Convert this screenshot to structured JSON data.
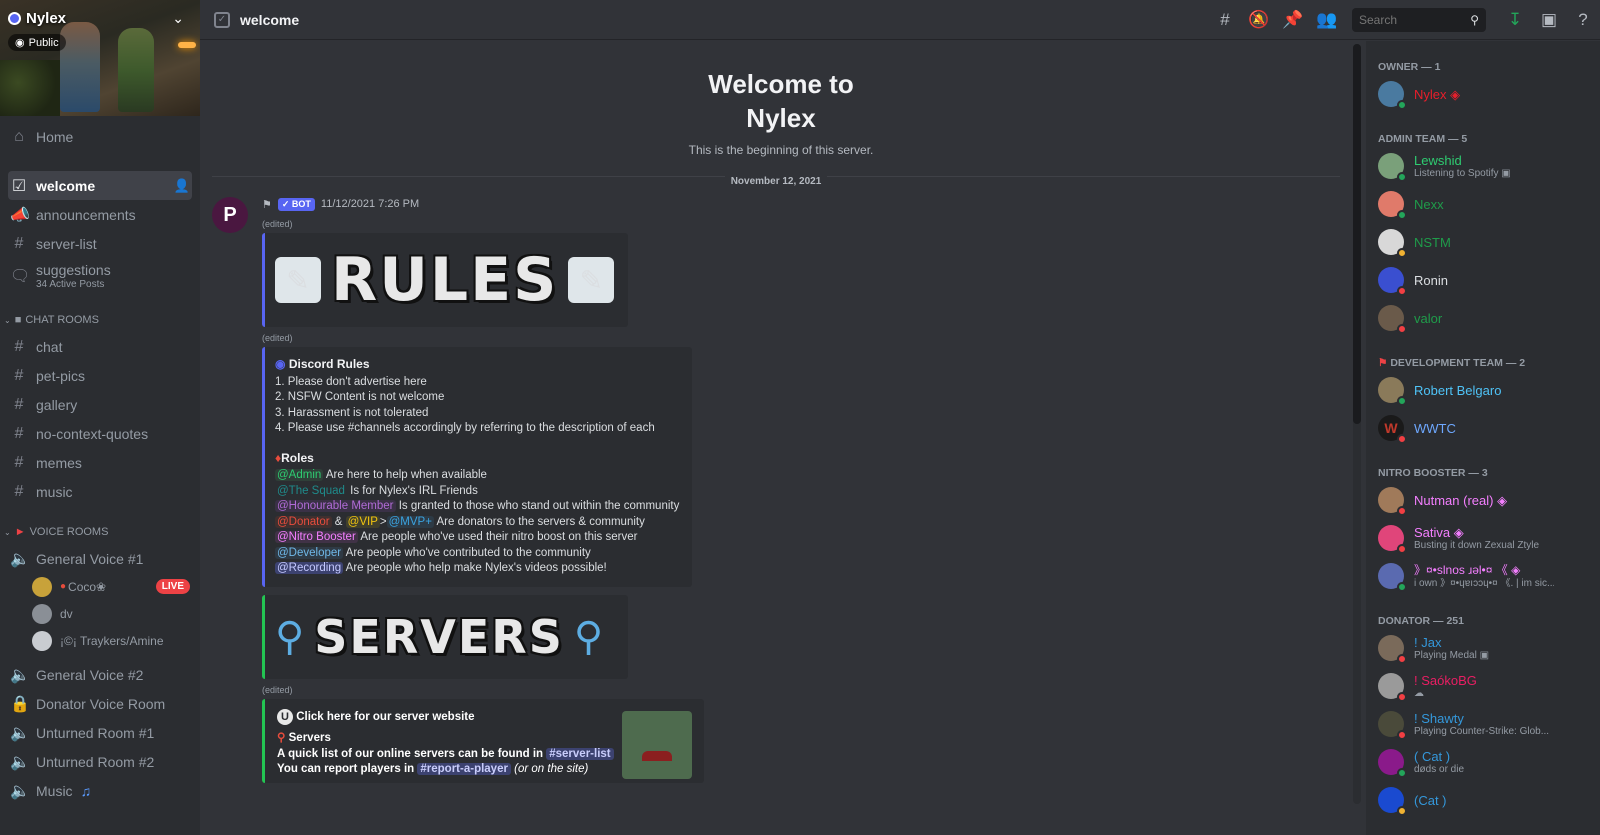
{
  "server": {
    "name": "Nylex",
    "visibility": "Public"
  },
  "sidebar": {
    "home": "Home",
    "channels": [
      {
        "label": "welcome",
        "icon": "rules-icon",
        "active": true
      },
      {
        "label": "announcements",
        "icon": "megaphone-icon"
      },
      {
        "label": "server-list",
        "icon": "hash-icon"
      },
      {
        "label": "suggestions",
        "sub": "34 Active Posts",
        "icon": "forum-icon"
      }
    ],
    "chat_category": "CHAT ROOMS",
    "chat_channels": [
      "chat",
      "pet-pics",
      "gallery",
      "no-context-quotes",
      "memes",
      "music"
    ],
    "voice_category": "VOICE ROOMS",
    "voice_channels": [
      "General Voice #1",
      "General Voice #2",
      "Donator Voice Room",
      "Unturned Room #1",
      "Unturned Room #2",
      "Music"
    ],
    "voice_users": [
      {
        "name": "Coco❀",
        "live": "LIVE"
      },
      {
        "name": "dv"
      },
      {
        "name": "¡©¡ Traykers/Amine"
      }
    ]
  },
  "topbar": {
    "channel": "welcome",
    "search_placeholder": "Search"
  },
  "main": {
    "welcome_line1": "Welcome to",
    "welcome_line2": "Nylex",
    "welcome_sub": "This is the beginning of this server.",
    "date_divider": "November 12, 2021",
    "message": {
      "bot_tag": "✓ BOT",
      "timestamp": "11/12/2021 7:26 PM",
      "edited": "(edited)",
      "rules_banner": "RULES",
      "servers_banner": "SERVERS",
      "rules_embed": {
        "title": "Discord Rules",
        "lines": [
          "1. Please don't advertise here",
          "2. NSFW Content is not welcome",
          "3. Harassment is not tolerated",
          "4. Please use #channels accordingly by referring to the description of each"
        ],
        "roles_title": "Roles",
        "roles": [
          {
            "role": "@Admin",
            "desc": "Are here to help when available",
            "color": "#2ecc71"
          },
          {
            "role": "@The Squad",
            "desc": "Is for Nylex's IRL Friends",
            "color": "#1f8b8b"
          },
          {
            "role": "@Honourable Member",
            "desc": "Is granted to those who stand out within the community",
            "color": "#9b59b6"
          },
          {
            "role": "@Donator",
            "role2": "@VIP",
            "role3": "@MVP+",
            "desc": "Are donators to the servers & community",
            "color": "#e74c3c"
          },
          {
            "role": "@Nitro Booster",
            "desc": "Are people who've used their nitro boost on this server",
            "color": "#f47fff"
          },
          {
            "role": "@Developer",
            "desc": "Are people who've contributed to the community",
            "color": "#5dade2"
          },
          {
            "role": "@Recording",
            "desc": "Are people who help make Nylex's videos possible!",
            "color": "#aab4ff"
          }
        ],
        "amp": "&",
        "gt": ">"
      },
      "servers_embed": {
        "title": "Click here for our server website",
        "sub": "Servers",
        "line1": "A quick list of our online servers can be found in",
        "line1_channel": "#server-list",
        "line2": "You can report players in",
        "line2_channel": "#report-a-player",
        "line2_tail": "(or on the site)"
      }
    }
  },
  "members": {
    "groups": [
      {
        "title": "OWNER — 1",
        "list": [
          {
            "name": "Nylex ◈",
            "color": "#e91e2b",
            "status": "ok"
          }
        ]
      },
      {
        "title": "ADMIN TEAM — 5",
        "list": [
          {
            "name": "Lewshid",
            "sub": "Listening to Spotify ▣",
            "color": "#2ecc71",
            "status": "ok"
          },
          {
            "name": "Nexx",
            "color": "#1f9c4a",
            "status": "ok"
          },
          {
            "name": "NSTM",
            "color": "#1f9c4a",
            "status": "idle"
          },
          {
            "name": "Ronin",
            "color": "#dbdee1",
            "status": "dnd"
          },
          {
            "name": "valor",
            "color": "#1f9c4a",
            "status": "dnd"
          }
        ]
      },
      {
        "title": "DEVELOPMENT TEAM — 2",
        "list": [
          {
            "name": "Robert Belgaro",
            "color": "#4fc3f7",
            "status": "ok"
          },
          {
            "name": "WWTC",
            "color": "#6ea8ff",
            "status": "dnd"
          }
        ]
      },
      {
        "title": "NITRO BOOSTER — 3",
        "list": [
          {
            "name": "Nutman (real) ◈",
            "color": "#f47fff",
            "status": "dnd"
          },
          {
            "name": "Sativa ◈",
            "sub": "Busting it down Zexual Ztyle",
            "color": "#f47fff",
            "status": "dnd"
          },
          {
            "name": "》¤•slnos ɹǝl•¤ 《 ◈",
            "sub": "i own 》¤•ɥɐıɔɔɥ•¤ 《. | im sic...",
            "color": "#f47fff",
            "status": "ok"
          }
        ]
      },
      {
        "title": "DONATOR — 251",
        "list": [
          {
            "name": "! Jax",
            "sub": "Playing Medal ▣",
            "color": "#3498db",
            "status": "dnd"
          },
          {
            "name": "! SaókoBG",
            "sub": "☁",
            "color": "#e91e63",
            "status": "dnd"
          },
          {
            "name": "! Shawty",
            "sub": "Playing Counter-Strike: Glob...",
            "color": "#3498db",
            "status": "dnd"
          },
          {
            "name": "( Cat )",
            "sub": "døds or die",
            "color": "#3498db",
            "status": "ok"
          },
          {
            "name": "(Cat )",
            "color": "#3498db",
            "status": "idle"
          }
        ]
      }
    ]
  }
}
